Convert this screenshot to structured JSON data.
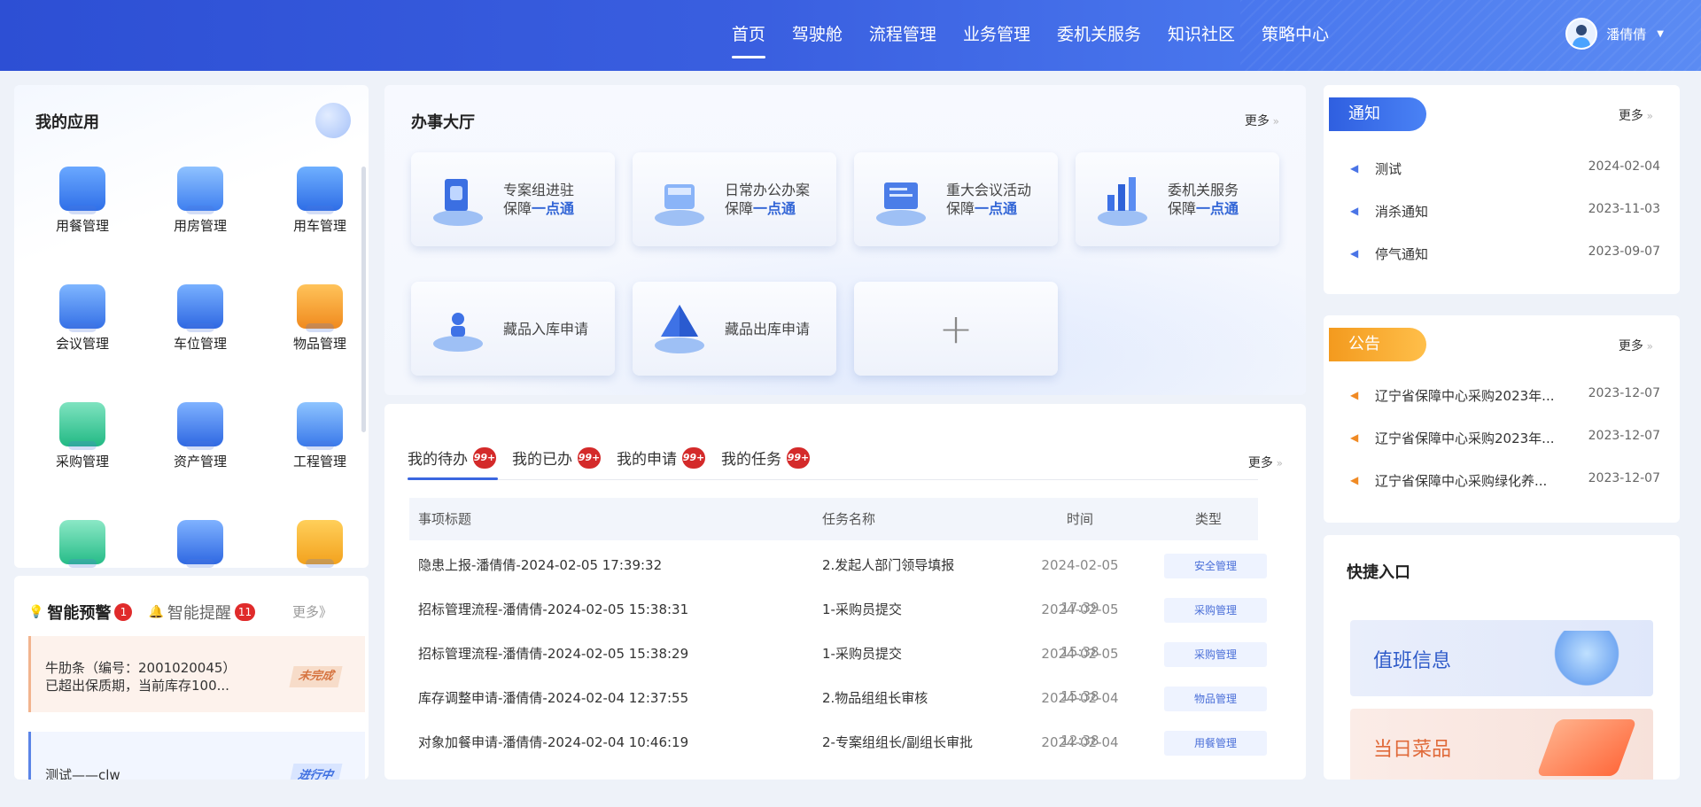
{
  "nav": {
    "items": [
      "首页",
      "驾驶舱",
      "流程管理",
      "业务管理",
      "委机关服务",
      "知识社区",
      "策略中心"
    ],
    "active_index": 0,
    "user_name": "潘倩倩"
  },
  "apps": {
    "title": "我的应用",
    "items": [
      {
        "label": "用餐管理",
        "icon": "utensils-icon"
      },
      {
        "label": "用房管理",
        "icon": "building-icon"
      },
      {
        "label": "用车管理",
        "icon": "car-icon"
      },
      {
        "label": "会议管理",
        "icon": "meeting-icon"
      },
      {
        "label": "车位管理",
        "icon": "parking-icon"
      },
      {
        "label": "物品管理",
        "icon": "goods-icon"
      },
      {
        "label": "采购管理",
        "icon": "purchase-icon"
      },
      {
        "label": "资产管理",
        "icon": "bank-icon"
      },
      {
        "label": "工程管理",
        "icon": "engineering-icon"
      },
      {
        "label": "",
        "icon": "monitor-shield-icon"
      },
      {
        "label": "",
        "icon": "document-icon"
      },
      {
        "label": "",
        "icon": "settings-doc-icon"
      }
    ]
  },
  "alerts": {
    "tab1_label": "智能预警",
    "tab1_count": "1",
    "tab2_label": "智能提醒",
    "tab2_count": "11",
    "more": "更多》",
    "card1_line1": "牛肋条（编号：2001020045）",
    "card1_line2": "已超出保质期，当前库存100...",
    "card1_status": "未完成",
    "card2_text": "测试——clw",
    "card2_status": "进行中"
  },
  "hall": {
    "title": "办事大厅",
    "more": "更多",
    "services": [
      {
        "line1": "专案组进驻",
        "line2a": "保障",
        "line2b": "一点通",
        "icon": "shield-doc-icon"
      },
      {
        "line1": "日常办公办案",
        "line2a": "保障",
        "line2b": "一点通",
        "icon": "office-icon"
      },
      {
        "line1": "重大会议活动",
        "line2a": "保障",
        "line2b": "一点通",
        "icon": "conference-icon"
      },
      {
        "line1": "委机关服务",
        "line2a": "保障",
        "line2b": "一点通",
        "icon": "bar-chart-icon"
      },
      {
        "line1": "藏品入库申请",
        "line2a": "",
        "line2b": "",
        "icon": "collection-in-icon"
      },
      {
        "line1": "藏品出库申请",
        "line2a": "",
        "line2b": "",
        "icon": "pyramid-icon"
      }
    ],
    "add_symbol": "+"
  },
  "todo": {
    "tabs": [
      {
        "label": "我的待办",
        "badge": "99+"
      },
      {
        "label": "我的已办",
        "badge": "99+"
      },
      {
        "label": "我的申请",
        "badge": "99+"
      },
      {
        "label": "我的任务",
        "badge": "99+"
      }
    ],
    "more": "更多",
    "columns": [
      "事项标题",
      "任务名称",
      "时间",
      "类型"
    ],
    "rows": [
      {
        "title": "隐患上报-潘倩倩-2024-02-05 17:39:32",
        "task": "2.发起人部门领导填报",
        "time": "2024-02-05 17:39",
        "type": "安全管理"
      },
      {
        "title": "招标管理流程-潘倩倩-2024-02-05 15:38:31",
        "task": "1-采购员提交",
        "time": "2024-02-05 15:38",
        "type": "采购管理"
      },
      {
        "title": "招标管理流程-潘倩倩-2024-02-05 15:38:29",
        "task": "1-采购员提交",
        "time": "2024-02-05 15:38",
        "type": "采购管理"
      },
      {
        "title": "库存调整申请-潘倩倩-2024-02-04 12:37:55",
        "task": "2.物品组组长审核",
        "time": "2024-02-04 12:38",
        "type": "物品管理"
      },
      {
        "title": "对象加餐申请-潘倩倩-2024-02-04 10:46:19",
        "task": "2-专案组组长/副组长审批",
        "time": "2024-02-04 10:46",
        "type": "用餐管理"
      }
    ]
  },
  "notice": {
    "title": "通知",
    "more": "更多",
    "items": [
      {
        "title": "测试",
        "date": "2024-02-04"
      },
      {
        "title": "消杀通知",
        "date": "2023-11-03"
      },
      {
        "title": "停气通知",
        "date": "2023-09-07"
      }
    ]
  },
  "bulletin": {
    "title": "公告",
    "more": "更多",
    "items": [
      {
        "title": "辽宁省保障中心采购2023年...",
        "date": "2023-12-07"
      },
      {
        "title": "辽宁省保障中心采购2023年...",
        "date": "2023-12-07"
      },
      {
        "title": "辽宁省保障中心采购绿化养...",
        "date": "2023-12-07"
      }
    ]
  },
  "quick": {
    "title": "快捷入口",
    "items": [
      "值班信息",
      "当日菜品"
    ]
  }
}
